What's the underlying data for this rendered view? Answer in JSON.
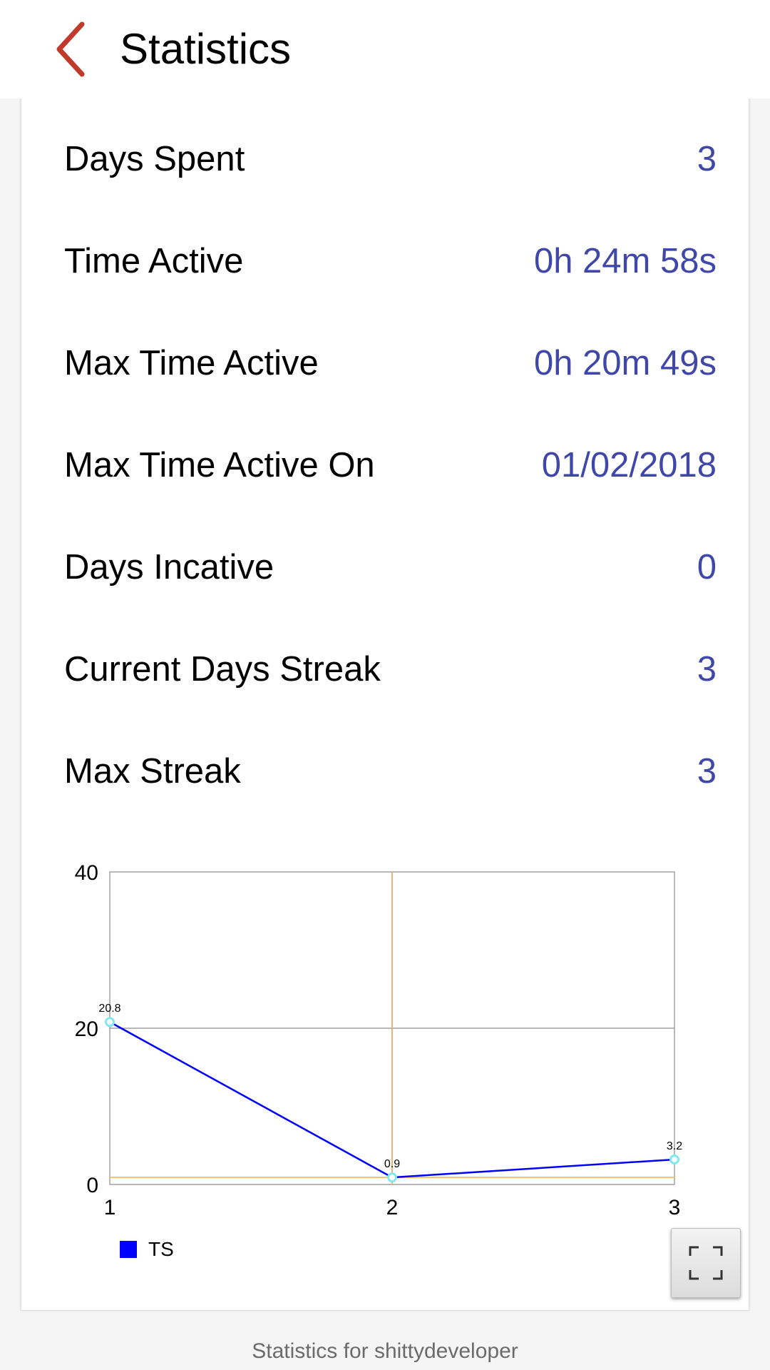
{
  "appbar": {
    "title": "Statistics",
    "back_icon": "chevron-left-icon",
    "accent_color": "#c0392b"
  },
  "stats": [
    {
      "label": "Days Spent",
      "value": "3"
    },
    {
      "label": "Time Active",
      "value": "0h 24m 58s"
    },
    {
      "label": "Max Time Active",
      "value": "0h 20m 49s"
    },
    {
      "label": "Max Time Active On",
      "value": "01/02/2018"
    },
    {
      "label": "Days Incative",
      "value": "0"
    },
    {
      "label": "Current Days Streak",
      "value": "3"
    },
    {
      "label": "Max Streak",
      "value": "3"
    }
  ],
  "chart_data": {
    "type": "line",
    "x": [
      1,
      2,
      3
    ],
    "xticks": [
      "1",
      "2",
      "3"
    ],
    "ylim": [
      0,
      40
    ],
    "yticks": [
      "0",
      "20",
      "40"
    ],
    "series": [
      {
        "name": "TS",
        "values": [
          20.8,
          0.9,
          3.2
        ],
        "labels": [
          "20.8",
          "0.9",
          "3.2"
        ],
        "color": "#0000ff"
      }
    ],
    "grid": true,
    "legend": "bottom-left",
    "marker_color": "#7fe8f0"
  },
  "fullscreen_icon": "fullscreen-icon",
  "footer": {
    "text": "Statistics for shittydeveloper"
  }
}
